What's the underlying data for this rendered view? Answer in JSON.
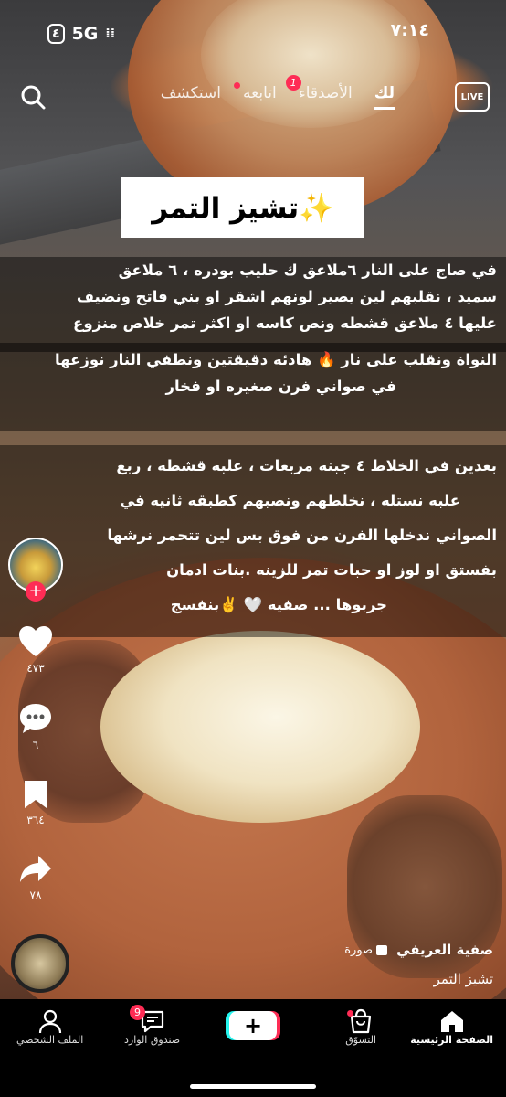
{
  "status_bar": {
    "time": "٧:١٤",
    "network": "5G",
    "battery": "٤"
  },
  "top_nav": {
    "items": [
      {
        "label": "استكشف"
      },
      {
        "label": "اتابعه"
      },
      {
        "label": "الأصدقاء",
        "badge": "1"
      },
      {
        "label": "لك",
        "active": true
      }
    ],
    "live_label": "LIVE"
  },
  "post": {
    "title": "تشيز التمر✨",
    "caption_lines_1": [
      "في صاج على النار  ٦ملاعق ك حليب  بودره ، ٦ ملاعق",
      "سميد ، نقلبهم لين يصير لونهم اشقر او بني فاتح ونضيف",
      "عليها ٤ ملاعق قشطه ونص كاسه او اكثر تمر خلاص منزوع"
    ],
    "caption_lines_2": [
      "النواة  ونقلب على نار 🔥 هادئه دقيقتين ونطفي النار نوزعها",
      "في صواني فرن   صغيره او فخار"
    ],
    "caption_lines_3": [
      "بعدين في الخلاط ٤ جبنه مربعات ، علبه قشطه ، ربع",
      "علبه نستله ، نخلطهم ونصبهم كطبقه ثانيه في",
      "الصواني ندخلها الفرن من فوق بس لين تتحمر نرشها",
      "بفستق او لوز او حبات تمر للزينه .بنات ادمان",
      "جربوها ... صفيه 🤍 ✌️بنفسج"
    ],
    "likes": "٤٧٣",
    "comments": "٦",
    "saves": "٣٦٤",
    "shares": "٧٨",
    "author": "صفية العريفي",
    "type_tag": "صورة",
    "description": "تشيز التمر"
  },
  "bottom_nav": {
    "home": "الصفحة الرئيسية",
    "shop": "التسوّق",
    "create": "+",
    "inbox": "صندوق الوارد",
    "inbox_badge": "9",
    "profile": "الملف الشخصي"
  },
  "colors": {
    "accent": "#fe2c55",
    "cyan": "#25f4ee"
  }
}
